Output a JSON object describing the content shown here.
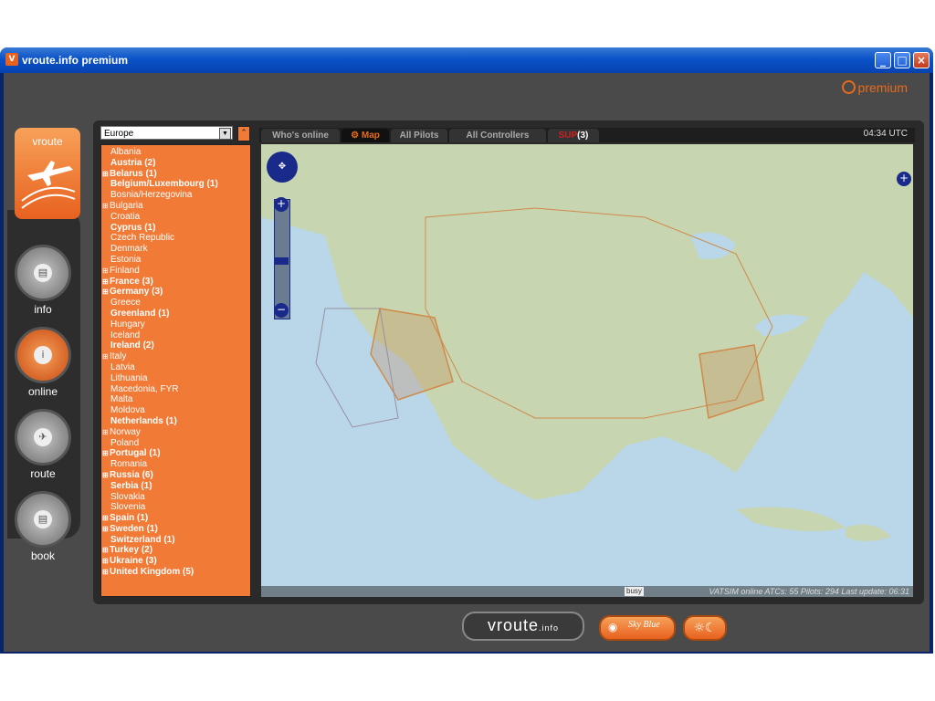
{
  "window": {
    "title": "vroute.info premium",
    "badge": "premium"
  },
  "sidenav": {
    "logo_label": "vroute",
    "items": [
      {
        "label": "info"
      },
      {
        "label": "online"
      },
      {
        "label": "route"
      },
      {
        "label": "book"
      }
    ]
  },
  "region_select": {
    "value": "Europe"
  },
  "countries": [
    {
      "text": "Albania",
      "bold": false,
      "exp": false
    },
    {
      "text": "Austria (2)",
      "bold": true,
      "exp": false
    },
    {
      "text": "Belarus (1)",
      "bold": true,
      "exp": true
    },
    {
      "text": "Belgium/Luxembourg (1)",
      "bold": true,
      "exp": false
    },
    {
      "text": "Bosnia/Herzegovina",
      "bold": false,
      "exp": false
    },
    {
      "text": "Bulgaria",
      "bold": false,
      "exp": true
    },
    {
      "text": "Croatia",
      "bold": false,
      "exp": false
    },
    {
      "text": "Cyprus (1)",
      "bold": true,
      "exp": false
    },
    {
      "text": "Czech Republic",
      "bold": false,
      "exp": false
    },
    {
      "text": "Denmark",
      "bold": false,
      "exp": false
    },
    {
      "text": "Estonia",
      "bold": false,
      "exp": false
    },
    {
      "text": "Finland",
      "bold": false,
      "exp": true
    },
    {
      "text": "France (3)",
      "bold": true,
      "exp": true
    },
    {
      "text": "Germany (3)",
      "bold": true,
      "exp": true
    },
    {
      "text": "Greece",
      "bold": false,
      "exp": false
    },
    {
      "text": "Greenland (1)",
      "bold": true,
      "exp": false
    },
    {
      "text": "Hungary",
      "bold": false,
      "exp": false
    },
    {
      "text": "Iceland",
      "bold": false,
      "exp": false
    },
    {
      "text": "Ireland (2)",
      "bold": true,
      "exp": false
    },
    {
      "text": "Italy",
      "bold": false,
      "exp": true
    },
    {
      "text": "Latvia",
      "bold": false,
      "exp": false
    },
    {
      "text": "Lithuania",
      "bold": false,
      "exp": false
    },
    {
      "text": "Macedonia, FYR",
      "bold": false,
      "exp": false
    },
    {
      "text": "Malta",
      "bold": false,
      "exp": false
    },
    {
      "text": "Moldova",
      "bold": false,
      "exp": false
    },
    {
      "text": "Netherlands (1)",
      "bold": true,
      "exp": false
    },
    {
      "text": "Norway",
      "bold": false,
      "exp": true
    },
    {
      "text": "Poland",
      "bold": false,
      "exp": false
    },
    {
      "text": "Portugal (1)",
      "bold": true,
      "exp": true
    },
    {
      "text": "Romania",
      "bold": false,
      "exp": false
    },
    {
      "text": "Russia (6)",
      "bold": true,
      "exp": true
    },
    {
      "text": "Serbia (1)",
      "bold": true,
      "exp": false
    },
    {
      "text": "Slovakia",
      "bold": false,
      "exp": false
    },
    {
      "text": "Slovenia",
      "bold": false,
      "exp": false
    },
    {
      "text": "Spain (1)",
      "bold": true,
      "exp": true
    },
    {
      "text": "Sweden (1)",
      "bold": true,
      "exp": true
    },
    {
      "text": "Switzerland (1)",
      "bold": true,
      "exp": false
    },
    {
      "text": "Turkey (2)",
      "bold": true,
      "exp": true
    },
    {
      "text": "Ukraine (3)",
      "bold": true,
      "exp": true
    },
    {
      "text": "United Kingdom (5)",
      "bold": true,
      "exp": true
    }
  ],
  "tabs": {
    "whos_online": "Who's online",
    "map": "Map",
    "all_pilots": "All Pilots",
    "all_controllers": "All Controllers",
    "sup": "SUP",
    "sup_count": "(3)"
  },
  "utc_time": "04:34 UTC",
  "map": {
    "status_busy": "busy",
    "status_text": "VATSIM online ATCs: 55 Pilots: 294 Last update: 06:31"
  },
  "bottombar": {
    "brand": "vroute",
    "brand_suffix": ".info",
    "skin_label": "Sky Blue"
  }
}
